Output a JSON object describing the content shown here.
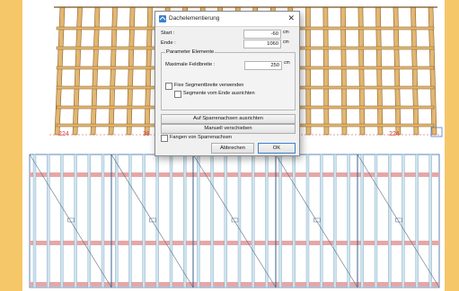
{
  "dialog": {
    "title": "Dachelementierung",
    "close_glyph": "✕",
    "start_label": "Start :",
    "start_value": "-60",
    "start_unit": "cm",
    "end_label": "Ende :",
    "end_value": "1060",
    "end_unit": "cm",
    "group_title": "Parameter Elemente",
    "max_width_label": "Maximale Feldbreite :",
    "max_width_value": "250",
    "max_width_unit": "cm",
    "fixed_segment_label": "Fixe Segmentbreite verwenden",
    "segment_from_end_label": "Segmente vom Ende ausrichten",
    "align_rafters_button": "Auf Sparrenachsen ausrichten",
    "manual_move_button": "Manuell verschieben",
    "catch_rafters_label": "Fangen von Sparrenachsen",
    "cancel_button": "Abbrechen",
    "ok_button": "OK"
  },
  "view3d": {
    "dim_labels": [
      "224",
      "38",
      "224"
    ]
  },
  "colors": {
    "background": "#f6c768",
    "wood": "#e3b772",
    "wood_edge": "#8a5f24",
    "stud": "#cfe3ec",
    "batten": "#e8a6a6",
    "accent": "#3c7fd0"
  },
  "icons": {
    "app": "roof-element-icon",
    "close": "close-icon"
  }
}
